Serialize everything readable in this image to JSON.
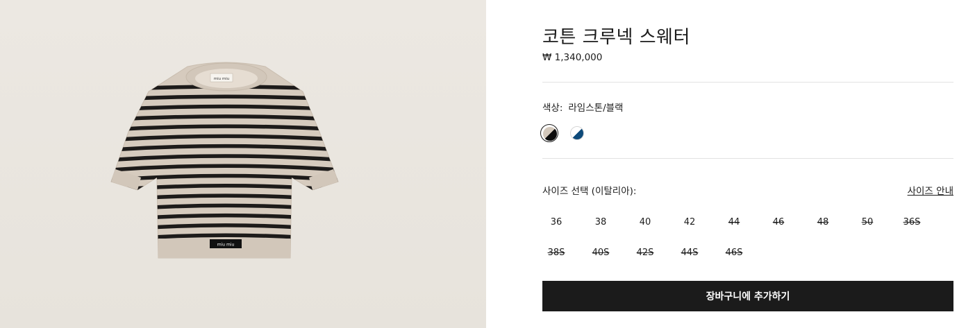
{
  "product": {
    "title": "코튼 크루넥 스웨터",
    "price": "₩ 1,340,000",
    "image": {
      "alt": "product-image",
      "brand_label_text": "miu miu"
    }
  },
  "color": {
    "label": "색상:",
    "selected_value": "라임스톤/블랙",
    "swatches": [
      {
        "name": "limestone-black",
        "colors": [
          "#d3c8bb",
          "#0c0c0c"
        ],
        "selected": true
      },
      {
        "name": "white-blue",
        "colors": [
          "#ffffff",
          "#0e4a7a"
        ],
        "selected": false
      }
    ]
  },
  "size": {
    "label": "사이즈 선택 (이탈리아):",
    "guide_link": "사이즈 안내",
    "options": [
      {
        "label": "36",
        "available": true
      },
      {
        "label": "38",
        "available": true
      },
      {
        "label": "40",
        "available": true
      },
      {
        "label": "42",
        "available": true
      },
      {
        "label": "44",
        "available": false
      },
      {
        "label": "46",
        "available": false
      },
      {
        "label": "48",
        "available": false
      },
      {
        "label": "50",
        "available": false
      },
      {
        "label": "36S",
        "available": false
      },
      {
        "label": "38S",
        "available": false
      },
      {
        "label": "40S",
        "available": false
      },
      {
        "label": "42S",
        "available": false
      },
      {
        "label": "44S",
        "available": false
      },
      {
        "label": "46S",
        "available": false
      }
    ]
  },
  "cart": {
    "button_label": "장바구니에 추가하기"
  }
}
